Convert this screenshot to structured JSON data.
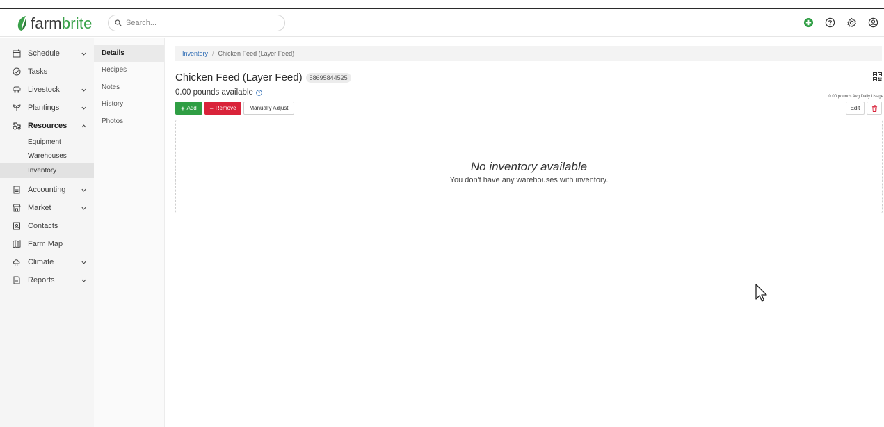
{
  "app": {
    "logo_word_a": "farm",
    "logo_word_b": "brite",
    "brand_color": "#3aa14a"
  },
  "search": {
    "placeholder": "Search..."
  },
  "top_icons": [
    "add-circle-icon",
    "help-icon",
    "settings-icon",
    "user-icon"
  ],
  "sidebar": {
    "items": [
      {
        "label": "Schedule",
        "icon": "calendar-icon",
        "chevron": "down"
      },
      {
        "label": "Tasks",
        "icon": "check-circle-icon"
      },
      {
        "label": "Livestock",
        "icon": "livestock-icon",
        "chevron": "down"
      },
      {
        "label": "Plantings",
        "icon": "sprout-icon",
        "chevron": "down"
      },
      {
        "label": "Resources",
        "icon": "tractor-icon",
        "chevron": "up"
      },
      {
        "label": "Accounting",
        "icon": "calculator-icon",
        "chevron": "down"
      },
      {
        "label": "Market",
        "icon": "market-icon",
        "chevron": "down"
      },
      {
        "label": "Contacts",
        "icon": "contacts-icon"
      },
      {
        "label": "Farm Map",
        "icon": "map-icon"
      },
      {
        "label": "Climate",
        "icon": "cloud-icon",
        "chevron": "down"
      },
      {
        "label": "Reports",
        "icon": "report-icon",
        "chevron": "down"
      }
    ],
    "resources_sub": [
      "Equipment",
      "Warehouses",
      "Inventory"
    ],
    "active_sub": "Inventory"
  },
  "subnav": {
    "items": [
      "Details",
      "Recipes",
      "Notes",
      "History",
      "Photos"
    ],
    "active": "Details"
  },
  "breadcrumb": {
    "link": "Inventory",
    "separator": "/",
    "current": "Chicken Feed (Layer Feed)"
  },
  "item": {
    "title": "Chicken Feed (Layer Feed)",
    "sku": "58695844525",
    "available": "0.00 pounds available",
    "avg_usage": "0.00 pounds Avg Daily Usage"
  },
  "buttons": {
    "add": "Add",
    "remove": "Remove",
    "adjust": "Manually Adjust",
    "edit": "Edit"
  },
  "empty_state": {
    "heading": "No inventory available",
    "message": "You don't have any warehouses with inventory."
  },
  "colors": {
    "add": "#2f9e44",
    "remove": "#d9233a",
    "link": "#2f6db5"
  }
}
